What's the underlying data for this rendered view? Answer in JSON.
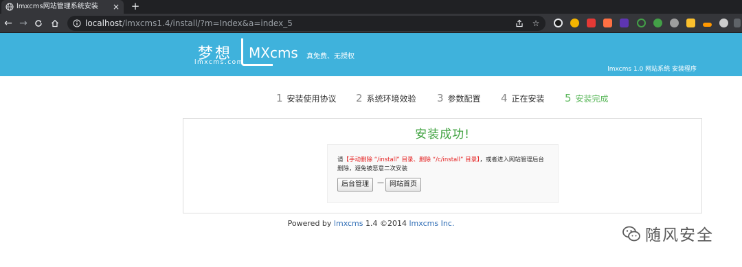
{
  "browser": {
    "tab_title": "lmxcms网站管理系统安装",
    "tab_close": "×",
    "new_tab": "+",
    "url_host": "localhost",
    "url_path": "/lmxcms1.4/install/?m=Index&a=index_5",
    "back": "←",
    "forward": "→",
    "reload": "C",
    "home": "⌂",
    "share_icon": "share-icon",
    "star": "☆",
    "extension_colors": [
      "#1a1a1a",
      "#f4b400",
      "#e53935",
      "#ff7043",
      "#5e35b1",
      "#2e7d32",
      "#43a047",
      "#9e9e9e",
      "#fbc02d",
      "#ff9800",
      "#cccccc",
      "#5f6368"
    ]
  },
  "header": {
    "logo_cn": "梦想",
    "logo_sub": "lmxcms.com",
    "logo_mx": "MXcms",
    "slogan": "真免费、无授权",
    "right_text": "lmxcms 1.0 网站系统 安装程序",
    "bg_color": "#3fb2dc"
  },
  "steps": [
    {
      "num": "1",
      "label": "安装使用协议",
      "done": false
    },
    {
      "num": "2",
      "label": "系统环境效验",
      "done": false
    },
    {
      "num": "3",
      "label": "参数配置",
      "done": false
    },
    {
      "num": "4",
      "label": "正在安装",
      "done": false
    },
    {
      "num": "5",
      "label": "安装完成",
      "done": true
    }
  ],
  "result": {
    "title": "安装成功!",
    "msg_prefix": "请",
    "msg_red": "【手动删除 “/install” 目录、删除 “/c/install” 目录】",
    "msg_suffix": "，或者进入网站管理后台删除，避免被恶意二次安装",
    "admin_button": "后台管理",
    "separator": "—",
    "home_button": "网站首页"
  },
  "footer": {
    "prefix": "Powered by ",
    "brand": "lmxcms",
    "middle": " 1.4 ©2014 ",
    "company": "lmxcms Inc."
  },
  "watermark": {
    "text": "随风安全"
  }
}
